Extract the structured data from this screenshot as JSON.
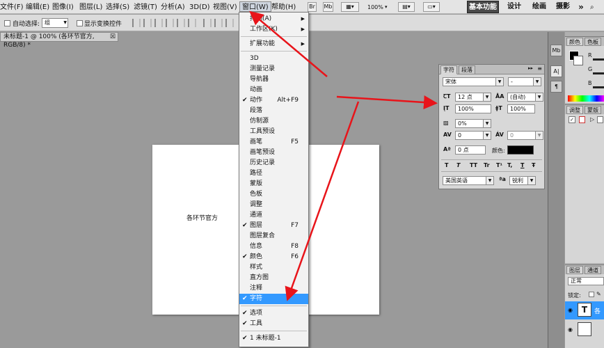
{
  "menubar": {
    "items": [
      "文件(F)",
      "编辑(E)",
      "图像(I)",
      "图层(L)",
      "选择(S)",
      "滤镜(T)",
      "分析(A)",
      "3D(D)",
      "视图(V)",
      "窗口(W)",
      "帮助(H)"
    ],
    "active_index": 9,
    "toolbar_icons": [
      "Br",
      "Mb"
    ],
    "zoom_value": "100%",
    "workspaces": [
      "基本功能",
      "设计",
      "绘画",
      "摄影",
      "»"
    ]
  },
  "options": {
    "auto_select_label": "自动选择:",
    "auto_select_value": "组",
    "show_transform_label": "显示变换控件"
  },
  "document": {
    "tab_title": "未标题-1 @ 100% (各环节官方, RGB/8) *",
    "canvas_text": "各环节官方"
  },
  "window_menu": {
    "items": [
      {
        "label": "排列(A)",
        "sub": true
      },
      {
        "label": "工作区(K)",
        "sub": true
      },
      {
        "sep": true
      },
      {
        "label": "扩展功能",
        "sub": true
      },
      {
        "sep": true
      },
      {
        "label": "3D"
      },
      {
        "label": "测量记录"
      },
      {
        "label": "导航器"
      },
      {
        "label": "动画"
      },
      {
        "label": "动作",
        "checked": true,
        "shortcut": "Alt+F9"
      },
      {
        "label": "段落"
      },
      {
        "label": "仿制源"
      },
      {
        "label": "工具预设"
      },
      {
        "label": "画笔",
        "shortcut": "F5"
      },
      {
        "label": "画笔预设"
      },
      {
        "label": "历史记录"
      },
      {
        "label": "路径"
      },
      {
        "label": "蒙版"
      },
      {
        "label": "色板"
      },
      {
        "label": "调整"
      },
      {
        "label": "通道"
      },
      {
        "label": "图层",
        "checked": true,
        "shortcut": "F7"
      },
      {
        "label": "图层复合"
      },
      {
        "label": "信息",
        "shortcut": "F8"
      },
      {
        "label": "颜色",
        "checked": true,
        "shortcut": "F6"
      },
      {
        "label": "样式"
      },
      {
        "label": "直方图"
      },
      {
        "label": "注释"
      },
      {
        "label": "字符",
        "checked": true,
        "selected": true
      },
      {
        "sep": true
      },
      {
        "label": "选项",
        "checked": true
      },
      {
        "label": "工具",
        "checked": true
      },
      {
        "sep": true
      },
      {
        "label": "1 未标题-1",
        "checked": true
      }
    ]
  },
  "character_panel": {
    "tabs": [
      "字符",
      "段落"
    ],
    "font_family": "宋体",
    "font_style": "-",
    "font_size": "12 点",
    "leading": "(自动)",
    "vertical_scale": "100%",
    "horizontal_scale": "100%",
    "tsume": "0%",
    "kerning": "0",
    "tracking": "0",
    "baseline_shift": "0 点",
    "color_label": "颜色:",
    "color_value": "#000000",
    "styles": [
      "T",
      "T",
      "TT",
      "Tr",
      "T¹",
      "T,",
      "T",
      "Ŧ"
    ],
    "language": "美国英语",
    "aa_label": "ªa",
    "anti_alias": "锐利"
  },
  "right_panels": {
    "color_tabs": [
      "颜色",
      "色板"
    ],
    "color_channels": [
      "R",
      "G",
      "B"
    ],
    "adjust_tabs": [
      "调整",
      "蒙版"
    ],
    "layers_tabs": [
      "图层",
      "通道"
    ],
    "blend_mode": "正常",
    "lock_label": "锁定:",
    "layer_name": "各",
    "layer_thumb": "T"
  },
  "colors": {
    "menu_highlight": "#3399ff",
    "arrow": "#e8141a"
  }
}
